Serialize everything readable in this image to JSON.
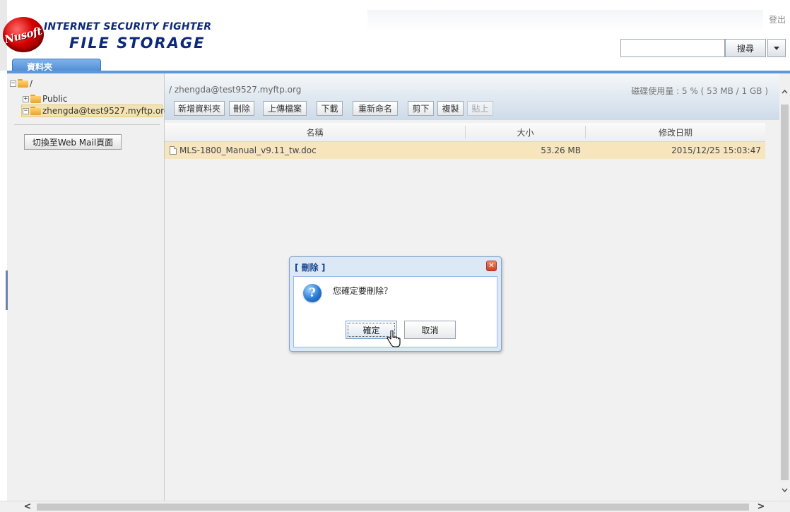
{
  "header": {
    "logo_brand": "Nusoft",
    "logo_line1": "INTERNET SECURITY FIGHTER",
    "logo_line2": "FILE STORAGE",
    "logout_label": "登出",
    "search_button_label": "搜尋",
    "search_input_value": "",
    "tab_label": "資料夾"
  },
  "tree": {
    "root_label": "/",
    "items": [
      {
        "label": "Public"
      },
      {
        "label": "zhengda@test9527.myftp.org"
      }
    ],
    "webmail_button_label": "切換至Web Mail頁面"
  },
  "main": {
    "path": "/ zhengda@test9527.myftp.org",
    "disk_usage": "磁碟使用量 : 5 % ( 53 MB / 1 GB )",
    "toolbar": {
      "new_folder": "新增資料夾",
      "delete": "刪除",
      "upload": "上傳檔案",
      "download": "下載",
      "rename": "重新命名",
      "cut": "剪下",
      "copy": "複製",
      "paste": "貼上"
    },
    "columns": {
      "name": "名稱",
      "size": "大小",
      "modified": "修改日期"
    },
    "files": [
      {
        "name": "MLS-1800_Manual_v9.11_tw.doc",
        "size": "53.26 MB",
        "modified": "2015/12/25 15:03:47"
      }
    ]
  },
  "dialog": {
    "title": "[ 刪除 ]",
    "message": "您確定要刪除？",
    "confirm_label": "確定",
    "cancel_label": "取消"
  },
  "scrollbars": {
    "left_arrow": "<",
    "right_arrow": ">",
    "up_arrow": "^",
    "down_arrow": "v"
  },
  "colors": {
    "accent_blue": "#5e98d8",
    "selection": "#f6e5bd",
    "logo_text": "#0d2a7a",
    "logo_red": "#d40000"
  }
}
